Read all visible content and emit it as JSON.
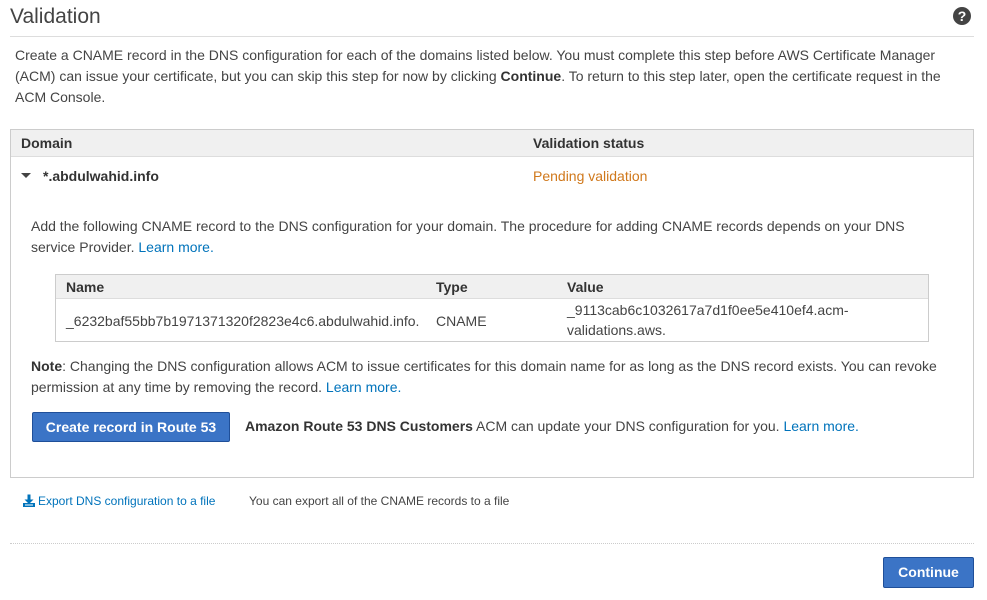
{
  "page": {
    "title": "Validation"
  },
  "intro": {
    "text_before": "Create a CNAME record in the DNS configuration for each of the domains listed below. You must complete this step before AWS Certificate Manager (ACM) can issue your certificate, but you can skip this step for now by clicking ",
    "bold": "Continue",
    "text_after": ". To return to this step later, open the certificate request in the ACM Console."
  },
  "domains_table": {
    "headers": {
      "domain": "Domain",
      "status": "Validation status"
    },
    "row": {
      "domain": "*.abdulwahid.info",
      "status": "Pending validation",
      "status_color": "#d0781b"
    }
  },
  "details": {
    "add_text": "Add the following CNAME record to the DNS configuration for your domain. The procedure for adding CNAME records depends on your DNS service Provider. ",
    "add_link": "Learn more.",
    "cname_table": {
      "headers": {
        "name": "Name",
        "type": "Type",
        "value": "Value"
      },
      "row": {
        "name": "_6232baf55bb7b1971371320f2823e4c6.abdulwahid.info.",
        "type": "CNAME",
        "value_line1": "_9113cab6c1032617a7d1f0ee5e410ef4.acm-",
        "value_line2": "validations.aws."
      }
    },
    "note_label": "Note",
    "note_text": ": Changing the DNS configuration allows ACM to issue certificates for this domain name for as long as the DNS record exists. You can revoke permission at any time by removing the record. ",
    "note_link": "Learn more.",
    "route53_button": "Create record in Route 53",
    "route53_bold": "Amazon Route 53 DNS Customers",
    "route53_text": " ACM can update your DNS configuration for you. ",
    "route53_link": "Learn more."
  },
  "export": {
    "icon": "download-icon",
    "link": "Export DNS configuration to a file",
    "description": "You can export all of the CNAME records to a file"
  },
  "footer": {
    "continue_button": "Continue"
  },
  "colors": {
    "accent": "#3b74c6",
    "link": "#0073bb",
    "pending": "#d0781b"
  }
}
